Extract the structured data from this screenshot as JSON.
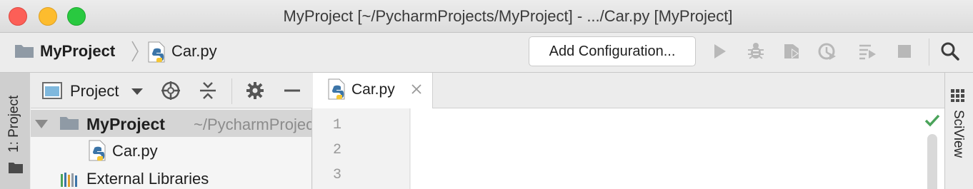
{
  "window": {
    "title": "MyProject [~/PycharmProjects/MyProject] - .../Car.py [MyProject]"
  },
  "navbar": {
    "project": "MyProject",
    "file": "Car.py",
    "add_configuration": "Add Configuration..."
  },
  "left_stripe": {
    "project_tool": "1: Project"
  },
  "project_panel": {
    "view_label": "Project",
    "tree": {
      "root_name": "MyProject",
      "root_path": "~/PycharmProjects/MyProject",
      "file": "Car.py",
      "external_libraries": "External Libraries"
    }
  },
  "editor": {
    "tab_label": "Car.py",
    "line_numbers": [
      "1",
      "2",
      "3"
    ]
  },
  "right_stripe": {
    "sciview": "SciView"
  },
  "colors": {
    "accent_green": "#4aa35a",
    "run_disabled": "#b8b8b8",
    "python_blue": "#3c75a8",
    "python_yellow": "#f5c634",
    "folder_gray": "#8f9aa5"
  },
  "icons": [
    "folder-icon",
    "python-file-icon",
    "run-icon",
    "debug-icon",
    "coverage-icon",
    "profile-icon",
    "concurrency-icon",
    "stop-icon",
    "search-icon",
    "locate-icon",
    "collapse-all-icon",
    "gear-icon",
    "hide-icon",
    "close-icon",
    "check-icon",
    "sciview-icon",
    "libraries-icon"
  ]
}
